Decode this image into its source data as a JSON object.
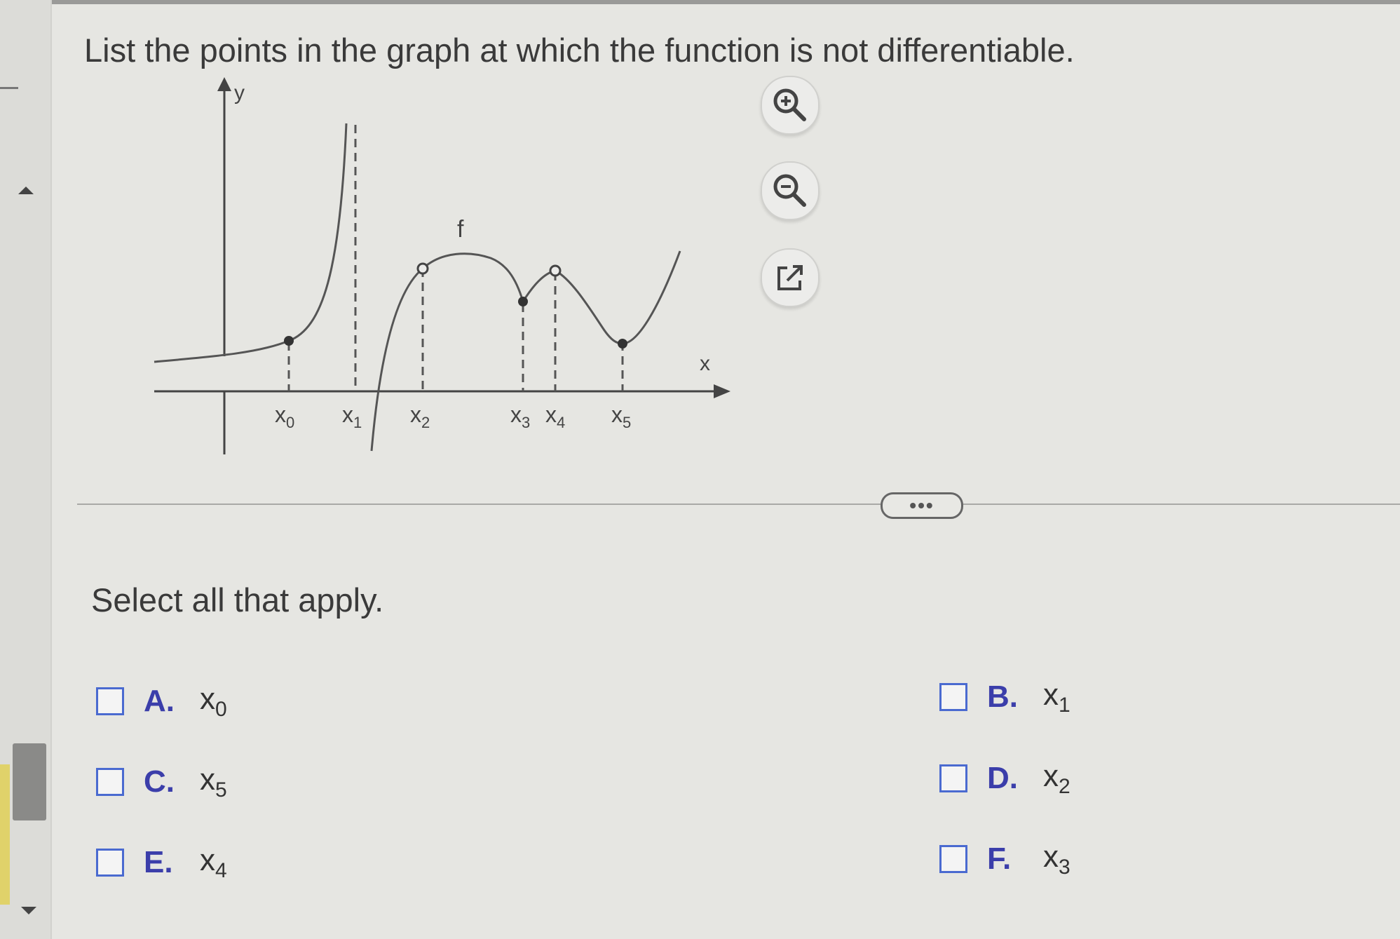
{
  "question": {
    "text": "List the points in the graph at which the function is not differentiable."
  },
  "graph": {
    "axis_y_label": "y",
    "axis_x_label": "x",
    "function_label": "f",
    "tick_labels": [
      {
        "base": "x",
        "sub": "0"
      },
      {
        "base": "x",
        "sub": "1"
      },
      {
        "base": "x",
        "sub": "2"
      },
      {
        "base": "x",
        "sub": "3"
      },
      {
        "base": "x",
        "sub": "4"
      },
      {
        "base": "x",
        "sub": "5"
      }
    ]
  },
  "tools": {
    "zoom_in_icon": "zoom-in-icon",
    "zoom_out_icon": "zoom-out-icon",
    "popout_icon": "external-link-icon"
  },
  "more_button": {
    "label": "•••"
  },
  "instruction": {
    "text": "Select all that apply."
  },
  "options": [
    {
      "letter": "A.",
      "base": "x",
      "sub": "0"
    },
    {
      "letter": "B.",
      "base": "x",
      "sub": "1"
    },
    {
      "letter": "C.",
      "base": "x",
      "sub": "5"
    },
    {
      "letter": "D.",
      "base": "x",
      "sub": "2"
    },
    {
      "letter": "E.",
      "base": "x",
      "sub": "4"
    },
    {
      "letter": "F.",
      "base": "x",
      "sub": "3"
    }
  ],
  "colors": {
    "accent": "#3b3eaa",
    "checkbox_border": "#4a6ad0",
    "background": "#e6e6e2"
  }
}
